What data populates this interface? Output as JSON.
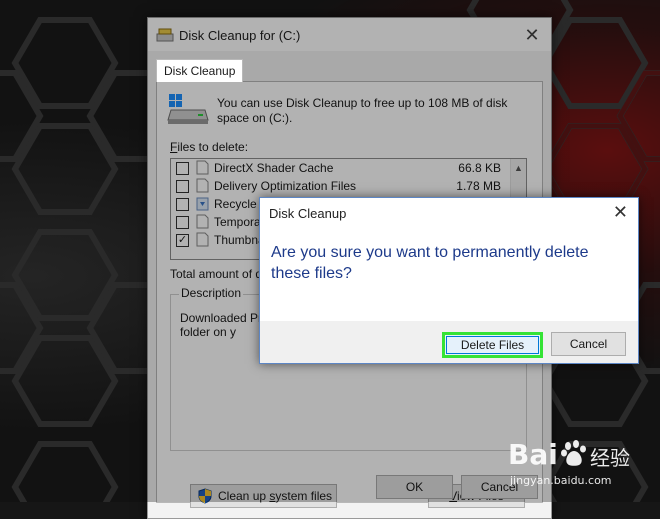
{
  "main_window": {
    "title": "Disk Cleanup for  (C:)",
    "tab_label": "Disk Cleanup",
    "intro_text": "You can use Disk Cleanup to free up to 108 MB of disk space on  (C:).",
    "files_label_prefix": "F",
    "files_label_rest": "iles to delete:",
    "files": [
      {
        "name": "DirectX Shader Cache",
        "size": "66.8 KB",
        "checked": false
      },
      {
        "name": "Delivery Optimization Files",
        "size": "1.78 MB",
        "checked": false
      },
      {
        "name": "Recycle",
        "size": "",
        "checked": false
      },
      {
        "name": "Tempora",
        "size": "",
        "checked": false
      },
      {
        "name": "Thumbna",
        "size": "",
        "checked": true
      }
    ],
    "total_label": "Total amount of d",
    "description_legend": "Description",
    "description_text": "Downloaded Pr downloaded au pages. They are Files folder on y",
    "cleanup_system_btn_pre": "Clean up ",
    "cleanup_system_btn_u": "s",
    "cleanup_system_btn_post": "ystem files",
    "view_files_btn_u": "V",
    "view_files_btn_rest": "iew Files",
    "ok_label": "OK",
    "cancel_label": "Cancel"
  },
  "dialog": {
    "title": "Disk Cleanup",
    "message": "Are you sure you want to permanently delete these files?",
    "delete_label": "Delete Files",
    "cancel_label": "Cancel"
  },
  "watermark": {
    "brand": "Bai",
    "brand_cn": "经验",
    "site": "jingyan.baidu.com"
  },
  "colors": {
    "highlight_border": "#35e335",
    "message_text": "#1d3a8a",
    "dialog_border": "#5c86c5"
  }
}
